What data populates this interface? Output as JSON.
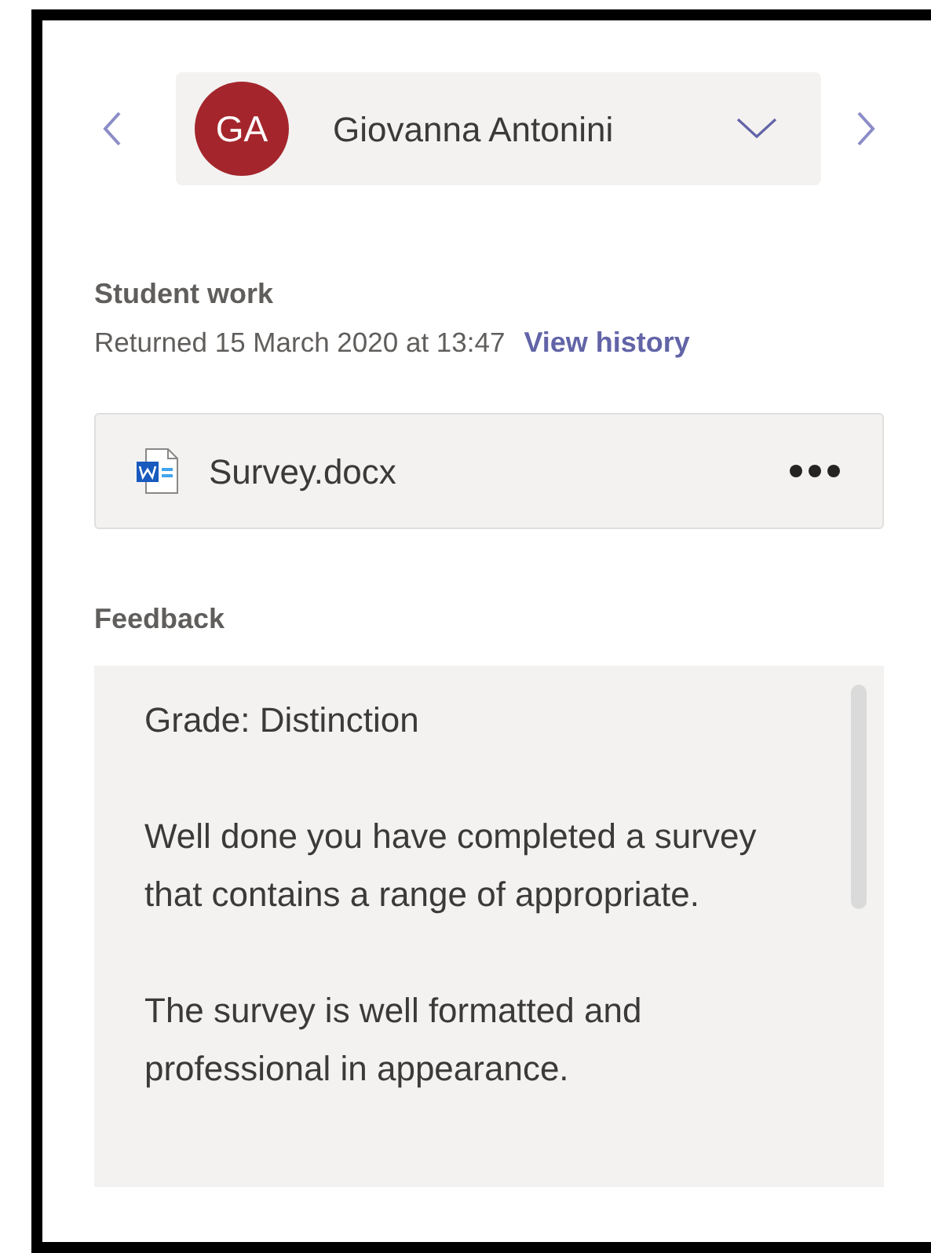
{
  "student_selector": {
    "initials": "GA",
    "name": "Giovanna Antonini"
  },
  "student_work": {
    "heading": "Student work",
    "status": "Returned 15 March 2020 at 13:47",
    "history_link": "View history"
  },
  "file": {
    "name": "Survey.docx"
  },
  "feedback": {
    "heading": "Feedback",
    "paragraphs": [
      "Grade: Distinction",
      "Well done you have completed a survey that contains a range of appropriate.",
      "The survey is well formatted and professional in appearance."
    ]
  }
}
